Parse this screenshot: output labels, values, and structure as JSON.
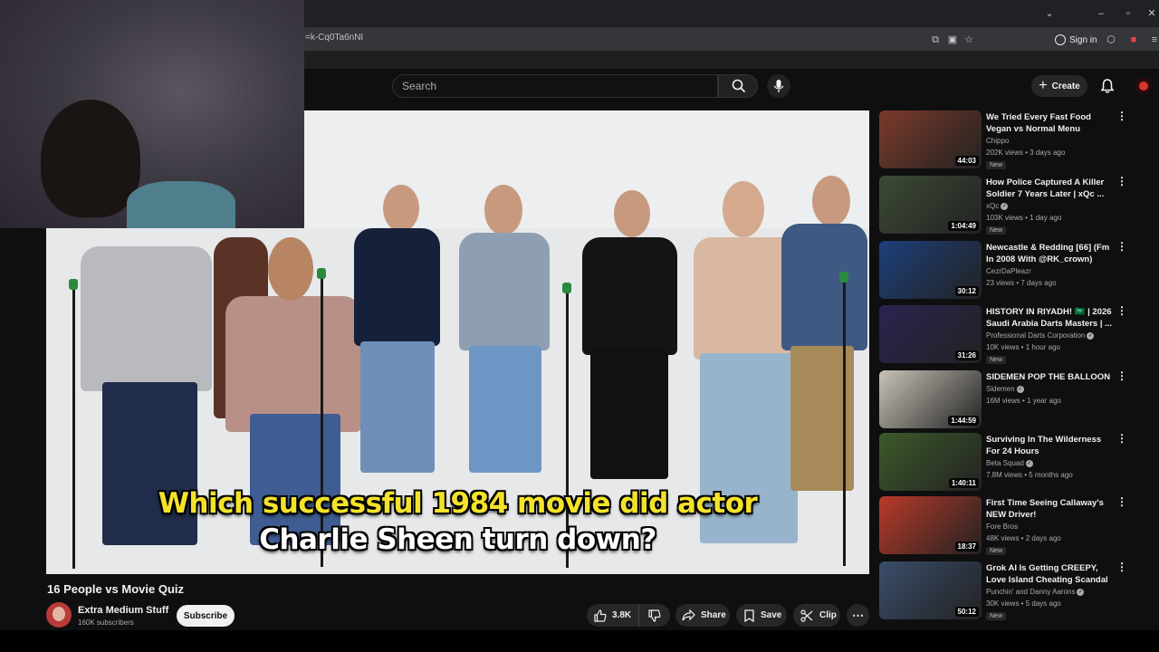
{
  "browser": {
    "address_fragment": "=k-Cq0Ta6nNI",
    "sign_in_label": "Sign in",
    "icons": [
      "minimize-icon",
      "restore-icon",
      "close-icon",
      "chevron-down-icon",
      "install-app-icon",
      "screenshot-icon",
      "bookmark-star-icon",
      "extensions-icon",
      "menu-icon"
    ]
  },
  "header": {
    "search_placeholder": "Search",
    "create_label": "Create"
  },
  "video": {
    "caption_line1": "Which successful 1984 movie did actor",
    "caption_line2": "Charlie Sheen turn down?",
    "title": "16 People vs Movie Quiz",
    "channel_name": "Extra Medium Stuff",
    "subscribers": "160K subscribers",
    "subscribe_label": "Subscribe",
    "likes": "3.8K",
    "share_label": "Share",
    "save_label": "Save",
    "clip_label": "Clip"
  },
  "recommendations": [
    {
      "title": "We Tried Every Fast Food Vegan vs Normal Menu",
      "channel": "Chippo",
      "verified": false,
      "meta": "202K views • 3 days ago",
      "badge": "New",
      "duration": "44:03",
      "color": "#7a3a2a"
    },
    {
      "title": "How Police Captured A Killer Soldier 7 Years Later | xQc ...",
      "channel": "xQc",
      "verified": true,
      "meta": "103K views • 1 day ago",
      "badge": "New",
      "duration": "1:04:49",
      "color": "#3c4a34"
    },
    {
      "title": "Newcastle & Redding [66] (Fm In 2008 With @RK_crown)",
      "channel": "CezrDaPleazr",
      "verified": false,
      "meta": "23 views • 7 days ago",
      "badge": "",
      "duration": "30:12",
      "color": "#1d3f7a"
    },
    {
      "title": "HISTORY IN RIYADH! 🇸🇦 | 2026 Saudi Arabia Darts Masters | ...",
      "channel": "Professional Darts Corporation",
      "verified": true,
      "meta": "10K views • 1 hour ago",
      "badge": "New",
      "duration": "31:26",
      "color": "#2a2450"
    },
    {
      "title": "SIDEMEN POP THE BALLOON",
      "channel": "Sidemen",
      "verified": true,
      "meta": "16M views • 1 year ago",
      "badge": "",
      "duration": "1:44:59",
      "color": "#c9c3b8"
    },
    {
      "title": "Surviving In The Wilderness For 24 Hours",
      "channel": "Beta Squad",
      "verified": true,
      "meta": "7.8M views • 5 months ago",
      "badge": "",
      "duration": "1:40:11",
      "color": "#3d5a2a"
    },
    {
      "title": "First Time Seeing Callaway's NEW Driver!",
      "channel": "Fore Bros",
      "verified": false,
      "meta": "48K views • 2 days ago",
      "badge": "New",
      "duration": "18:37",
      "color": "#b83a2a"
    },
    {
      "title": "Grok AI Is Getting CREEPY, Love Island Cheating Scandal & ...",
      "channel": "Punchin' and Danny Aarons",
      "verified": true,
      "meta": "30K views • 5 days ago",
      "badge": "New",
      "duration": "50:12",
      "color": "#3a4d6a"
    }
  ]
}
